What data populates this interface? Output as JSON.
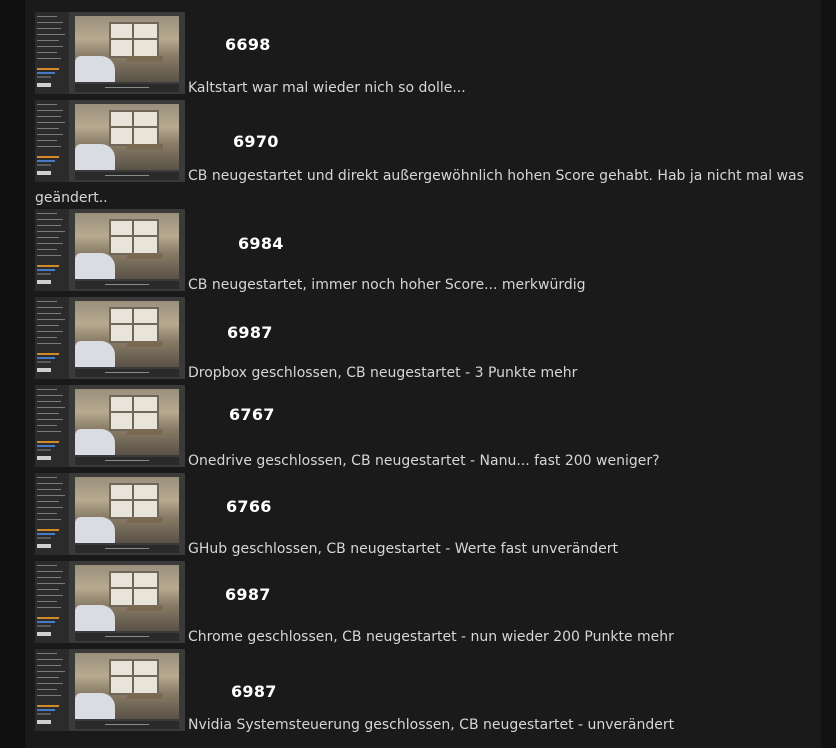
{
  "entries": [
    {
      "score": "6698",
      "text": "Kaltstart war mal wieder nich so dolle..."
    },
    {
      "score": "6970",
      "text": "CB neugestartet und direkt außergewöhnlich hohen Score gehabt. Hab ja nicht mal was",
      "text_cont": "geändert.."
    },
    {
      "score": "6984",
      "text": "CB neugestartet, immer noch hoher Score... merkwürdig"
    },
    {
      "score": "6987",
      "text": "Dropbox geschlossen, CB neugestartet - 3 Punkte mehr"
    },
    {
      "score": "6767",
      "text": "Onedrive geschlossen, CB neugestartet - Nanu... fast 200 weniger?"
    },
    {
      "score": "6766",
      "text": "GHub geschlossen, CB neugestartet - Werte fast unverändert"
    },
    {
      "score": "6987",
      "text": "Chrome geschlossen, CB neugestartet - nun wieder 200 Punkte mehr"
    },
    {
      "score": "6987",
      "text": "Nvidia Systemsteuerung geschlossen, CB neugestartet - unverändert"
    }
  ],
  "thumbnail": {
    "icon": "cinebench-screenshot-thumbnail"
  }
}
